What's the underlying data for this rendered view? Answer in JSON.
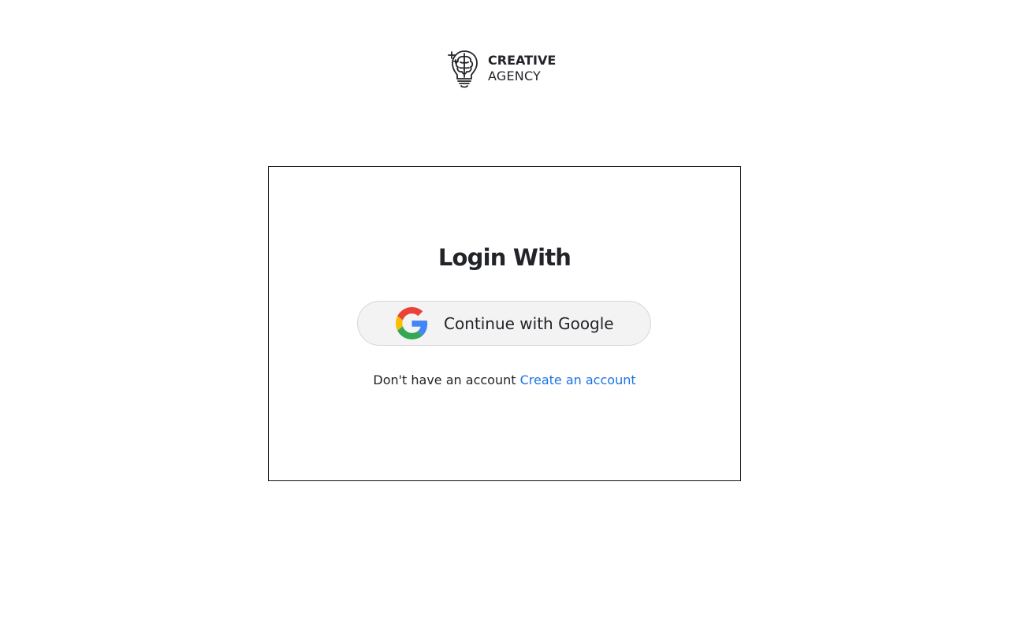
{
  "brand": {
    "name_line1": "CREATIVE",
    "name_line2": "AGENCY",
    "icon": "brain-bulb-logo-icon"
  },
  "login": {
    "title": "Login With",
    "google_button_label": "Continue with Google",
    "google_icon": "google-g-icon",
    "signup_prompt": "Don't have an account",
    "signup_link_label": "Create an account"
  },
  "colors": {
    "text": "#222429",
    "link": "#1a73e8",
    "button_bg": "#f3f3f3",
    "button_border": "#d6d6d6",
    "card_border": "#111111",
    "google_blue": "#4285F4",
    "google_red": "#EA4335",
    "google_yellow": "#FBBC05",
    "google_green": "#34A853"
  }
}
